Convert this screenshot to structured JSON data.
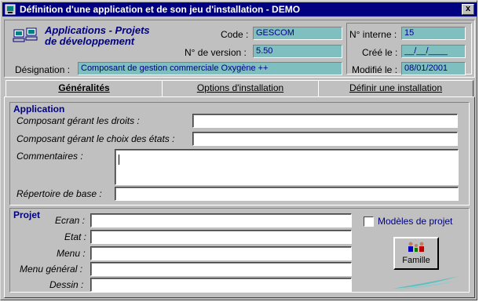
{
  "window": {
    "title": "Définition d'une application et de son jeu d'installation - DEMO",
    "close_label": "x"
  },
  "header": {
    "logo_line1": "Applications - Projets",
    "logo_line2": "de développement",
    "code_label": "Code :",
    "code_value": "GESCOM",
    "version_label": "N° de version :",
    "version_value": "5.50",
    "designation_label": "Désignation :",
    "designation_value": "Composant de gestion commerciale Oxygène ++",
    "internal_no_label": "N° interne :",
    "internal_no_value": "15",
    "created_label": "Créé le :",
    "created_value": "__/__/____",
    "modified_label": "Modifié le :",
    "modified_value": "08/01/2001"
  },
  "tabs": [
    {
      "label": "Généralités",
      "active": true
    },
    {
      "label": "Options d'installation",
      "active": false
    },
    {
      "label": "Définir une installation",
      "active": false
    }
  ],
  "application_group": {
    "title": "Application",
    "fields": [
      {
        "label": "Composant gérant les droits :",
        "value": ""
      },
      {
        "label": "Composant gérant le choix des états :",
        "value": ""
      },
      {
        "label": "Commentaires :",
        "value": ""
      },
      {
        "label": "Répertoire de base :",
        "value": ""
      }
    ]
  },
  "project_group": {
    "title": "Projet",
    "fields": [
      {
        "label": "Ecran :",
        "value": ""
      },
      {
        "label": "Etat :",
        "value": ""
      },
      {
        "label": "Menu :",
        "value": ""
      },
      {
        "label": "Menu général :",
        "value": ""
      },
      {
        "label": "Dessin :",
        "value": ""
      }
    ],
    "models_checkbox_label": "Modèles de projet",
    "models_checked": false,
    "family_button_label": "Famille"
  },
  "colors": {
    "title_bar": "#000080",
    "field_teal": "#7fbfbf",
    "accent_text": "#000080",
    "swoosh": "#5fbfbf"
  }
}
